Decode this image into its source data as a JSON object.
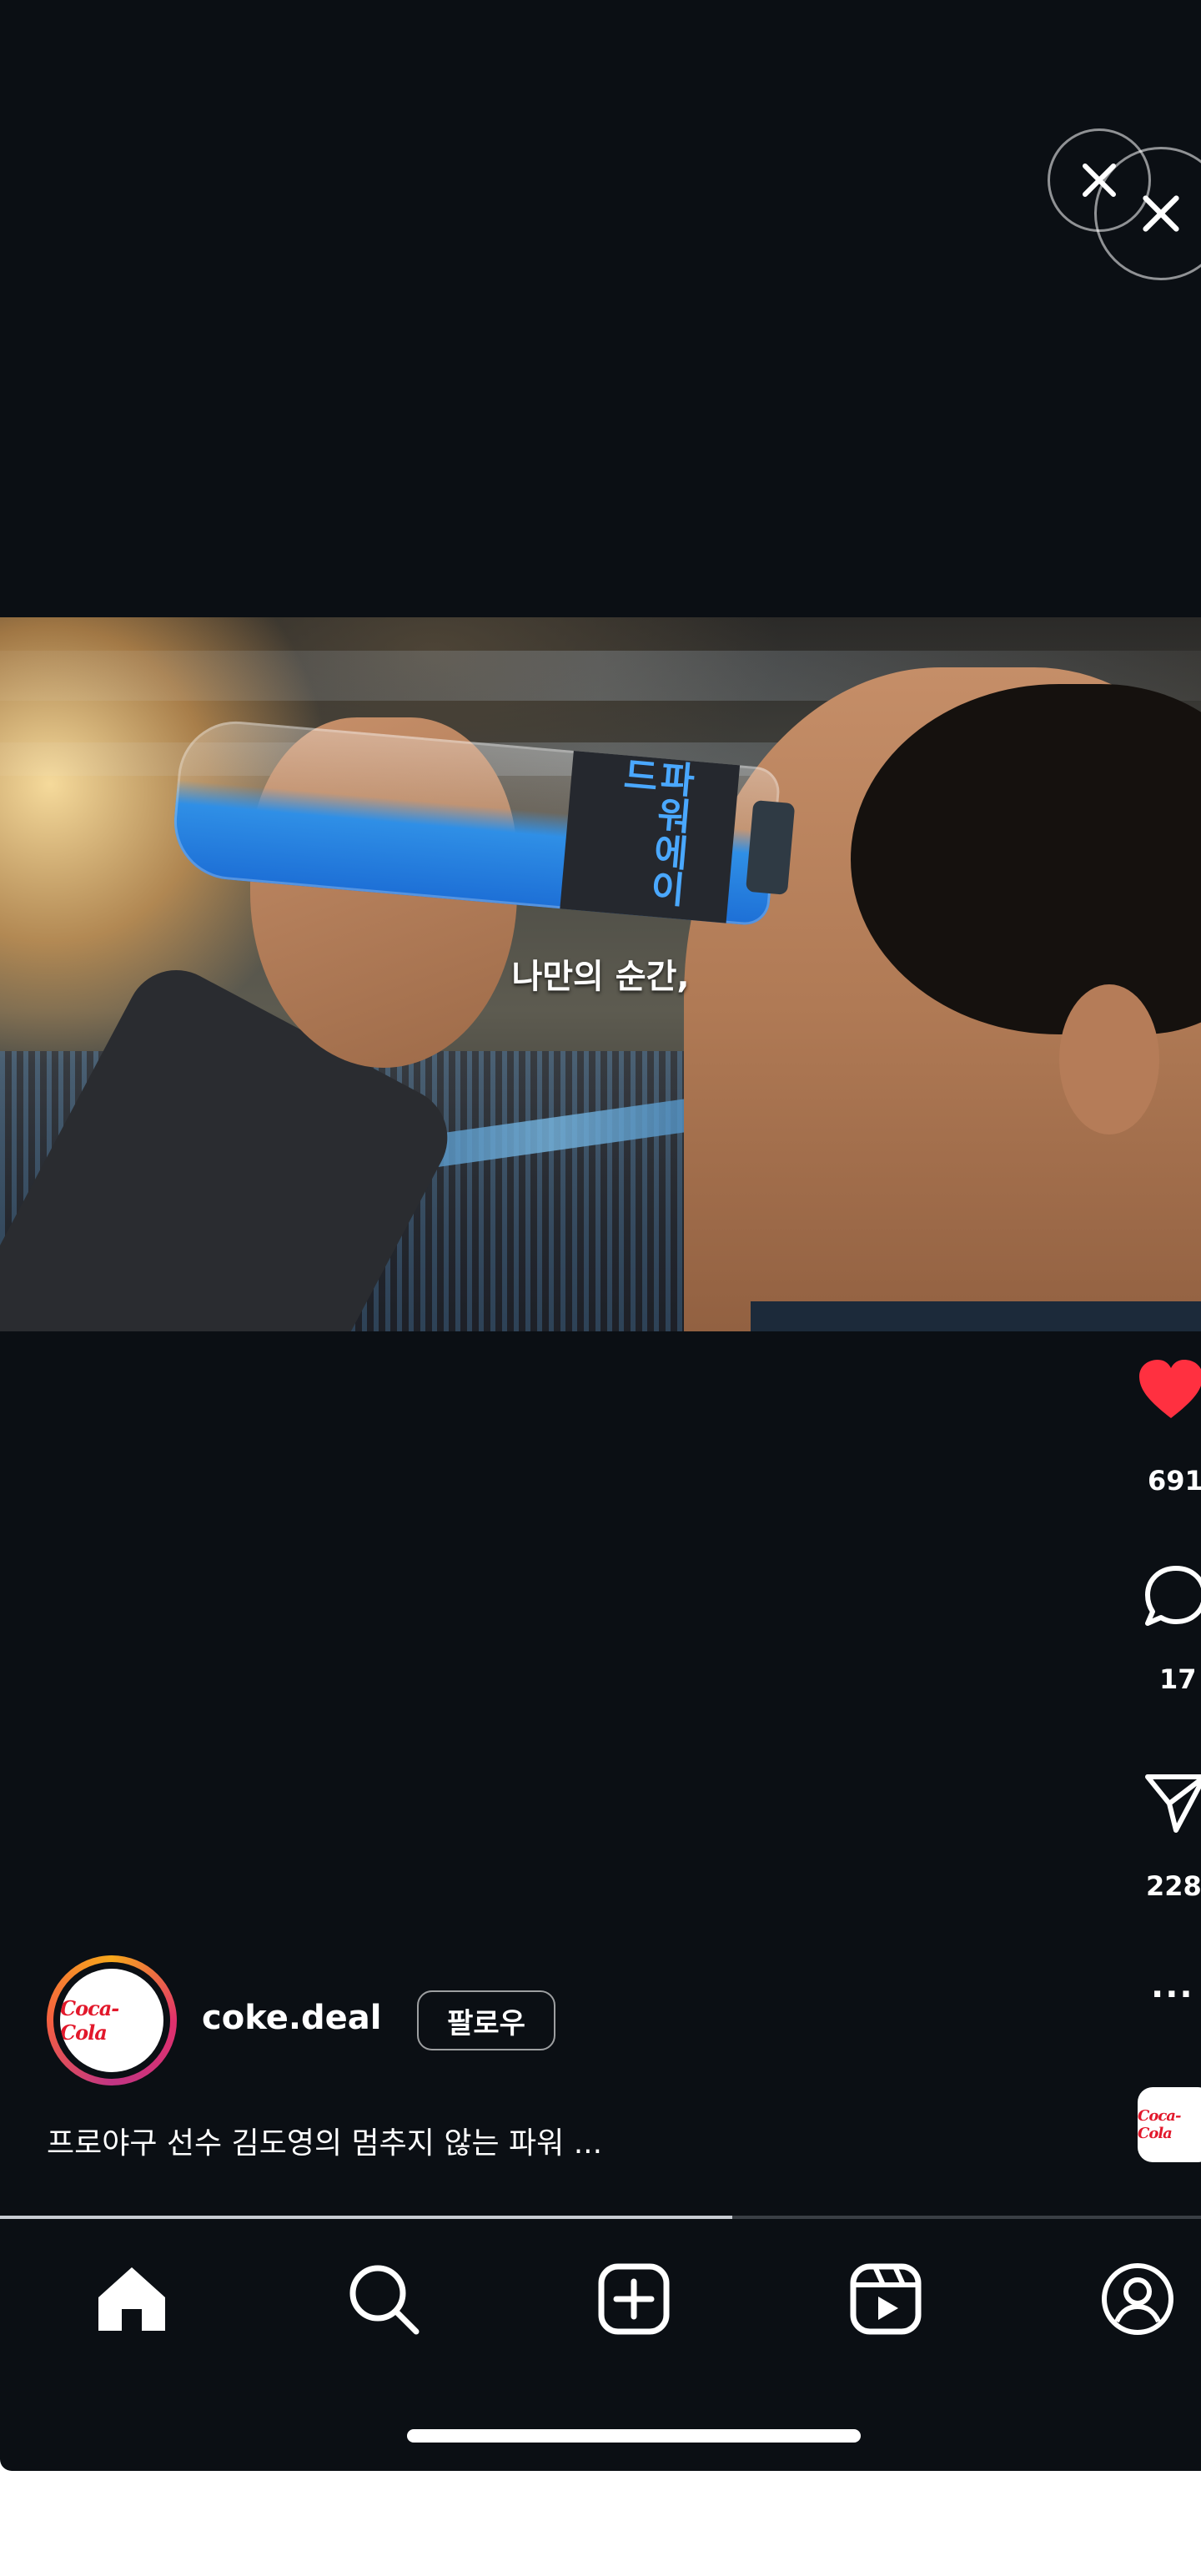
{
  "video": {
    "subtitle": "나만의 순간,",
    "bottle_label": "파워에이드",
    "progress_percent": 61
  },
  "actions": {
    "likes": "691",
    "comments": "17",
    "shares": "228",
    "more": "..."
  },
  "author": {
    "username": "coke.deal",
    "follow_label": "팔로우",
    "avatar_text": "Coca-Cola"
  },
  "caption": "프로야구 선수 김도영의 멈추지 않는 파워 ...",
  "colors": {
    "background": "#0b0f14",
    "like": "#ff3040",
    "brand_red": "#e2182b"
  },
  "icons": {
    "close": "close-icon",
    "like": "heart-filled-icon",
    "comment": "comment-icon",
    "share": "paper-plane-icon",
    "more": "more-icon",
    "nav": [
      "home-icon",
      "search-icon",
      "create-icon",
      "reels-icon",
      "profile-icon"
    ]
  }
}
